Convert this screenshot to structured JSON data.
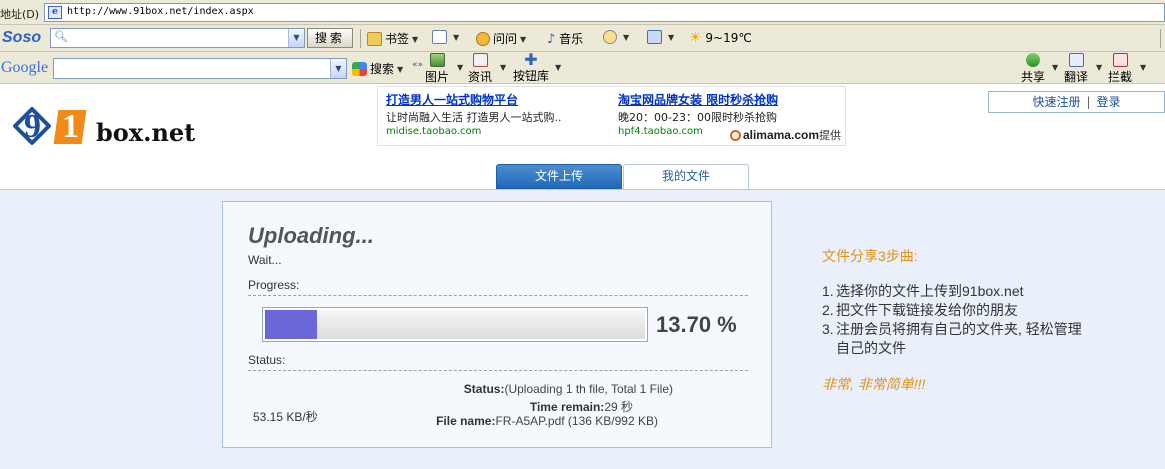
{
  "browser": {
    "address_label": "地址(D)",
    "url": "http://www.91box.net/index.aspx"
  },
  "soso_toolbar": {
    "logo": "Soso",
    "search_button": "搜索",
    "bookmarks": "书签",
    "ask": "问问",
    "music": "音乐",
    "weather": "9~19℃"
  },
  "google_toolbar": {
    "logo": "Google",
    "search": "搜索",
    "images": "图片",
    "news": "资讯",
    "button_gallery": "按钮库",
    "share": "共享",
    "translate": "翻译",
    "block": "拦截"
  },
  "header": {
    "logo_text": "box.net",
    "logo_digit_a": "9",
    "logo_digit_b": "1",
    "ad": {
      "left": {
        "title": "打造男人一站式购物平台",
        "desc": "让时尚融入生活 打造男人一站式购..",
        "url": "midise.taobao.com"
      },
      "right": {
        "title": "淘宝网品牌女装 限时秒杀抢购",
        "desc": "晚20：00-23：00限时秒杀抢购",
        "url": "hpf4.taobao.com"
      },
      "provider": "alimama.com",
      "provider_suffix": "提供"
    },
    "register": "快速注册",
    "separator": "|",
    "login": "登录"
  },
  "tabs": {
    "upload": "文件上传",
    "my_files": "我的文件"
  },
  "upload": {
    "title": "Uploading...",
    "wait": "Wait...",
    "progress_label": "Progress:",
    "progress_fraction": 0.137,
    "percent_text": "13.70 %",
    "status_label": "Status:",
    "speed": "53.15 KB/秒",
    "status_key": "Status:",
    "status_value": "(Uploading 1 th file, Total 1 File)",
    "time_key": "Time remain:",
    "time_value": "29 秒",
    "file_key": "File name:",
    "file_value": "FR-A5AP.pdf (136 KB/992 KB)",
    "colors": {
      "fill": "#6b67d8",
      "panel_border": "#a7c1e3"
    }
  },
  "steps": {
    "title": "文件分享3步曲:",
    "items": [
      {
        "num": "1.",
        "text": "选择你的文件上传到91box.net"
      },
      {
        "num": "2.",
        "text": "把文件下载链接发给你的朋友"
      },
      {
        "num": "3.",
        "text": "注册会员将拥有自己的文件夹, 轻松管理"
      }
    ],
    "item3_cont": "自己的文件",
    "note": "非常, 非常简单!!!"
  }
}
